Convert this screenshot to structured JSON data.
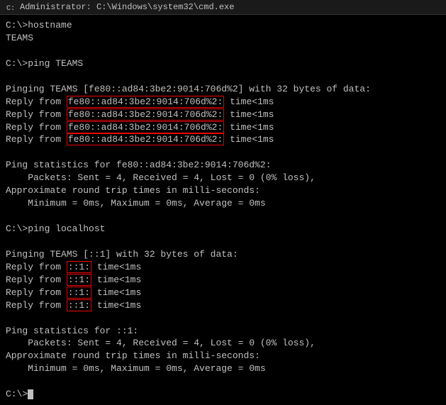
{
  "titleBar": {
    "icon": "cmd-icon",
    "title": "Administrator: C:\\Windows\\system32\\cmd.exe"
  },
  "lines": [
    {
      "id": "cmd1",
      "text": "C:\\>hostname"
    },
    {
      "id": "cmd1-out",
      "text": "TEAMS"
    },
    {
      "id": "blank1",
      "text": ""
    },
    {
      "id": "cmd2",
      "text": "C:\\>ping TEAMS"
    },
    {
      "id": "blank2",
      "text": ""
    },
    {
      "id": "ping1-hdr",
      "text": "Pinging TEAMS [fe80::ad84:3be2:9014:706d%2] with 32 bytes of data:"
    },
    {
      "id": "reply1",
      "prefix": "Reply from ",
      "highlight": "fe80::ad84:3be2:9014:706d%2:",
      "suffix": " time<1ms"
    },
    {
      "id": "reply2",
      "prefix": "Reply from ",
      "highlight": "fe80::ad84:3be2:9014:706d%2:",
      "suffix": " time<1ms"
    },
    {
      "id": "reply3",
      "prefix": "Reply from ",
      "highlight": "fe80::ad84:3be2:9014:706d%2:",
      "suffix": " time<1ms"
    },
    {
      "id": "reply4",
      "prefix": "Reply from ",
      "highlight": "fe80::ad84:3be2:9014:706d%2:",
      "suffix": " time<1ms"
    },
    {
      "id": "blank3",
      "text": ""
    },
    {
      "id": "stat1",
      "text": "Ping statistics for fe80::ad84:3be2:9014:706d%2:"
    },
    {
      "id": "stat2",
      "text": "    Packets: Sent = 4, Received = 4, Lost = 0 (0% loss),"
    },
    {
      "id": "stat3",
      "text": "Approximate round trip times in milli-seconds:"
    },
    {
      "id": "stat4",
      "text": "    Minimum = 0ms, Maximum = 0ms, Average = 0ms"
    },
    {
      "id": "blank4",
      "text": ""
    },
    {
      "id": "cmd3",
      "text": "C:\\>ping localhost"
    },
    {
      "id": "blank5",
      "text": ""
    },
    {
      "id": "ping2-hdr",
      "text": "Pinging TEAMS [::1] with 32 bytes of data:"
    },
    {
      "id": "reply5",
      "prefix": "Reply from ",
      "highlight": "::1:",
      "suffix": " time<1ms"
    },
    {
      "id": "reply6",
      "prefix": "Reply from ",
      "highlight": "::1:",
      "suffix": " time<1ms"
    },
    {
      "id": "reply7",
      "prefix": "Reply from ",
      "highlight": "::1:",
      "suffix": " time<1ms"
    },
    {
      "id": "reply8",
      "prefix": "Reply from ",
      "highlight": "::1:",
      "suffix": " time<1ms"
    },
    {
      "id": "blank6",
      "text": ""
    },
    {
      "id": "stat5",
      "text": "Ping statistics for ::1:"
    },
    {
      "id": "stat6",
      "text": "    Packets: Sent = 4, Received = 4, Lost = 0 (0% loss),"
    },
    {
      "id": "stat7",
      "text": "Approximate round trip times in milli-seconds:"
    },
    {
      "id": "stat8",
      "text": "    Minimum = 0ms, Maximum = 0ms, Average = 0ms"
    },
    {
      "id": "blank7",
      "text": ""
    },
    {
      "id": "prompt",
      "text": "C:\\>"
    }
  ]
}
